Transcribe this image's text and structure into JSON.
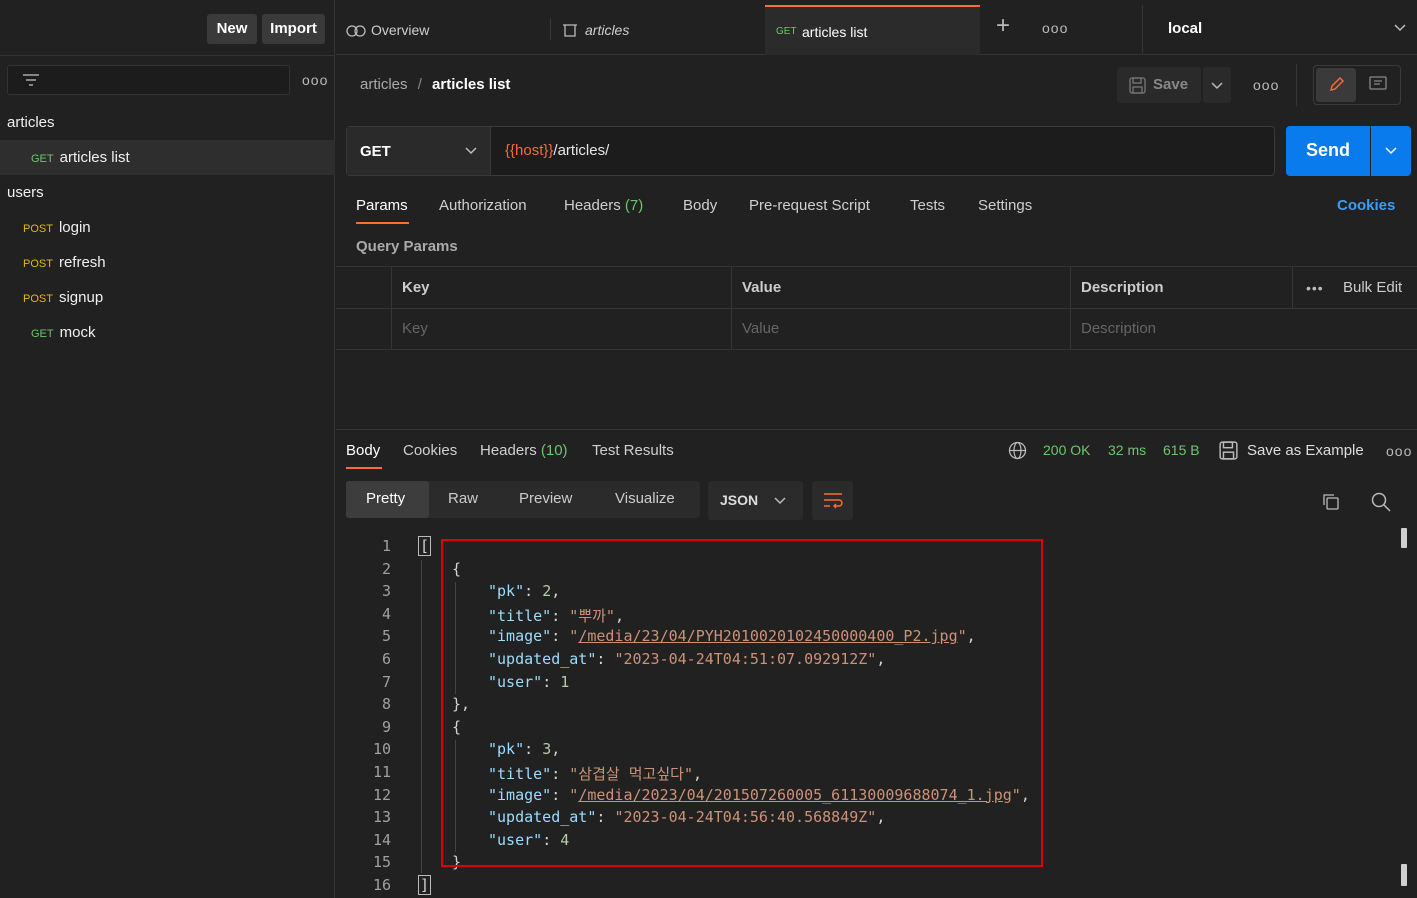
{
  "sidebar": {
    "new_label": "New",
    "import_label": "Import",
    "folders": [
      {
        "name": "articles",
        "items": [
          {
            "method": "GET",
            "label": "articles list"
          }
        ]
      },
      {
        "name": "users",
        "items": [
          {
            "method": "POST",
            "label": "login"
          },
          {
            "method": "POST",
            "label": "refresh"
          },
          {
            "method": "POST",
            "label": "signup"
          },
          {
            "method": "GET",
            "label": "mock"
          }
        ]
      }
    ]
  },
  "tabs": {
    "overview": "Overview",
    "articles": "articles",
    "active_method": "GET",
    "active_label": "articles list",
    "environment": "local"
  },
  "breadcrumb": {
    "parent": "articles",
    "separator": "/",
    "current": "articles list"
  },
  "toolbar": {
    "save_label": "Save"
  },
  "request": {
    "method": "GET",
    "url_var": "{{host}}",
    "url_path": "/articles/",
    "send_label": "Send"
  },
  "request_tabs": {
    "params": "Params",
    "authorization": "Authorization",
    "headers": "Headers",
    "headers_count": "(7)",
    "body": "Body",
    "prerequest": "Pre-request Script",
    "tests": "Tests",
    "settings": "Settings",
    "cookies": "Cookies"
  },
  "query_params": {
    "title": "Query Params",
    "columns": [
      "Key",
      "Value",
      "Description"
    ],
    "bulk_edit": "Bulk Edit",
    "placeholders": [
      "Key",
      "Value",
      "Description"
    ]
  },
  "response_tabs": {
    "body": "Body",
    "cookies": "Cookies",
    "headers": "Headers",
    "headers_count": "(10)",
    "test_results": "Test Results"
  },
  "response_status": {
    "status": "200 OK",
    "time": "32 ms",
    "size": "615 B",
    "save_example": "Save as Example"
  },
  "view_modes": {
    "pretty": "Pretty",
    "raw": "Raw",
    "preview": "Preview",
    "visualize": "Visualize",
    "format": "JSON"
  },
  "code": {
    "line_numbers": [
      "1",
      "2",
      "3",
      "4",
      "5",
      "6",
      "7",
      "8",
      "9",
      "10",
      "11",
      "12",
      "13",
      "14",
      "15",
      "16"
    ],
    "records": [
      {
        "pk": "2",
        "title": "뿌까",
        "image": "/media/23/04/PYH2010020102450000400_P2.jpg",
        "updated_at": "2023-04-24T04:51:07.092912Z",
        "user": "1"
      },
      {
        "pk": "3",
        "title": "삼겹살 먹고싶다",
        "image": "/media/2023/04/201507260005_61130009688074_1.jpg",
        "updated_at": "2023-04-24T04:56:40.568849Z",
        "user": "4"
      }
    ]
  },
  "colors": {
    "accent": "#ff6c37",
    "send": "#097bed",
    "highlight_box": "#e00000"
  }
}
